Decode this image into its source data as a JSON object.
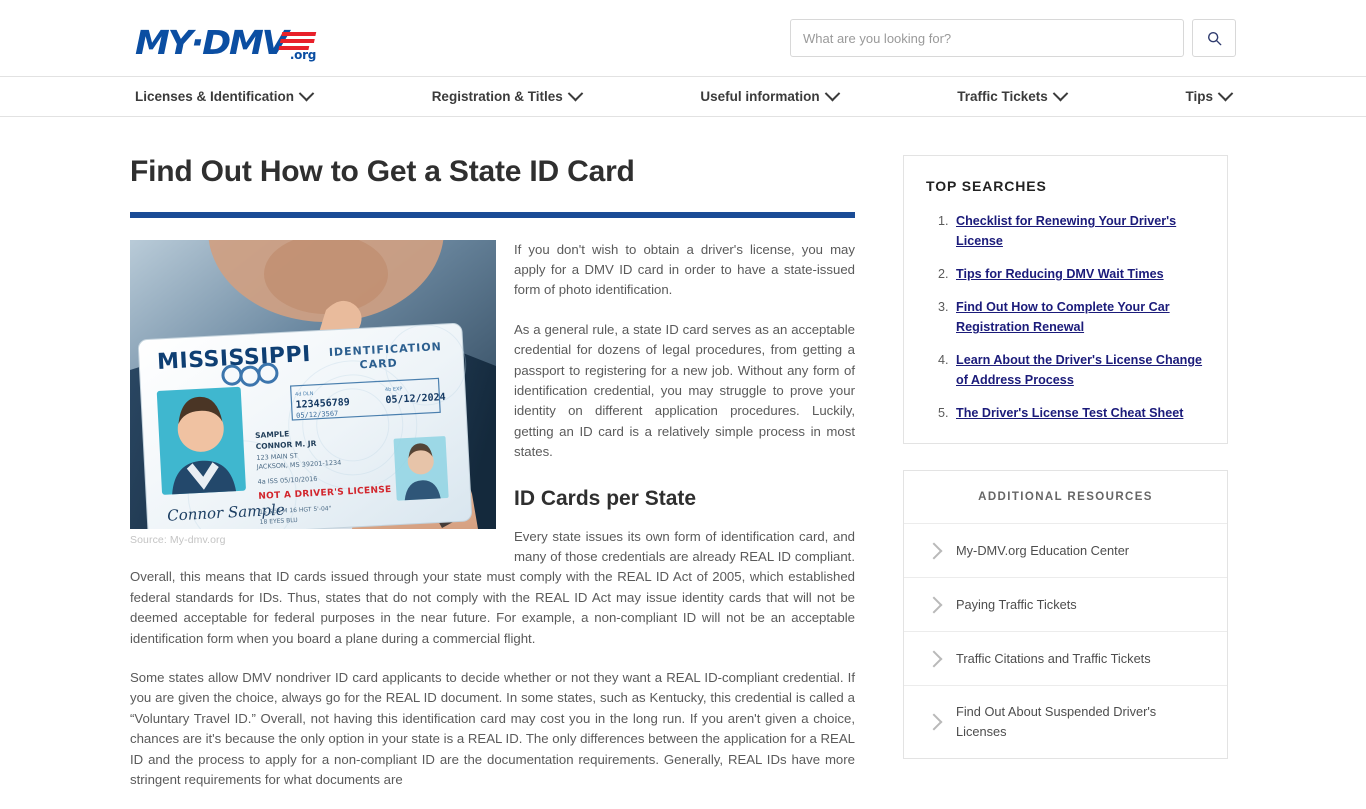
{
  "header": {
    "logo": {
      "text": "MY·DMV",
      "tld": ".org",
      "icon": "flag-stripes-icon"
    },
    "search": {
      "placeholder": "What are you looking for?",
      "value": "",
      "button_icon": "search-icon"
    }
  },
  "nav": {
    "items": [
      {
        "label": "Licenses & Identification",
        "icon": "chevron-down-icon"
      },
      {
        "label": "Registration & Titles",
        "icon": "chevron-down-icon"
      },
      {
        "label": "Useful information",
        "icon": "chevron-down-icon"
      },
      {
        "label": "Traffic Tickets",
        "icon": "chevron-down-icon"
      },
      {
        "label": "Tips",
        "icon": "chevron-down-icon"
      }
    ]
  },
  "article": {
    "title": "Find Out How to Get a State ID Card",
    "figure": {
      "caption": "Source: My-dmv.org",
      "alt": "Hand holding a Mississippi identification card",
      "card": {
        "state": "MISSISSIPPI",
        "type_line1": "IDENTIFICATION",
        "type_line2": "CARD",
        "id_number": "123456789",
        "exp_date": "05/12/2024",
        "dln_label": "4b EXP",
        "sub_number": "05/12/3567",
        "name_line1": "SAMPLE",
        "name_line2": "CONNOR M. JR",
        "address_line1": "123 MAIN ST",
        "address_line2": "JACKSON, MS 39201-1234",
        "issue_date": "05/10/2016",
        "notice": "NOT A DRIVER'S LICENSE",
        "sex": "M",
        "height": "5'-04\"",
        "eyes": "BLU",
        "signature": "Connor Sample"
      }
    },
    "paragraphs": [
      "If you don't wish to obtain a driver's license, you may apply for a DMV ID card in order to have a state-issued form of photo identification.",
      "As a general rule, a state ID card serves as an acceptable credential for dozens of legal procedures, from getting a passport to registering for a new job. Without any form of identification credential, you may struggle to prove your identity on different application procedures. Luckily, getting an ID card is a relatively simple process in most states."
    ],
    "section_title": "ID Cards per State",
    "section_paragraphs": [
      "Every state issues its own form of identification card, and many of those credentials are already REAL ID compliant. Overall, this means that ID cards issued through your state must comply with the REAL ID Act of 2005, which established federal standards for IDs. Thus, states that do not comply with the REAL ID Act may issue identity cards that will not be deemed acceptable for federal purposes in the near future. For example, a non-compliant ID will not be an acceptable identification form when you board a plane during a commercial flight.",
      "Some states allow DMV nondriver ID card applicants to decide whether or not they want a REAL ID-compliant credential. If you are given the choice, always go for the REAL ID document. In some states, such as Kentucky, this credential is called a “Voluntary Travel ID.” Overall, not having this identification card may cost you in the long run. If you aren't given a choice, chances are it's because the only option in your state is a REAL ID. The only differences between the application for a REAL ID and the process to apply for a non-compliant ID are the documentation requirements. Generally, REAL IDs have more stringent requirements for what documents are"
    ]
  },
  "sidebar": {
    "top_searches": {
      "heading": "TOP SEARCHES",
      "items": [
        {
          "label": "Checklist for Renewing Your Driver's License"
        },
        {
          "label": "Tips for Reducing DMV Wait Times"
        },
        {
          "label": "Find Out How to Complete Your Car Registration Renewal"
        },
        {
          "label": "Learn About the Driver's License Change of Address Process"
        },
        {
          "label": "The Driver's License Test Cheat Sheet"
        }
      ]
    },
    "additional_resources": {
      "heading": "ADDITIONAL RESOURCES",
      "items": [
        {
          "label": "My-DMV.org Education Center",
          "icon": "chevron-right-icon"
        },
        {
          "label": "Paying Traffic Tickets",
          "icon": "chevron-right-icon"
        },
        {
          "label": "Traffic Citations and Traffic Tickets",
          "icon": "chevron-right-icon"
        },
        {
          "label": "Find Out About Suspended Driver's Licenses",
          "icon": "chevron-right-icon"
        }
      ]
    }
  },
  "colors": {
    "brand_blue": "#0b4ea2",
    "brand_red": "#e8202a",
    "rule_blue": "#1a4c96",
    "link_navy": "#1b1b7a",
    "body_text": "#5a5a5a"
  }
}
